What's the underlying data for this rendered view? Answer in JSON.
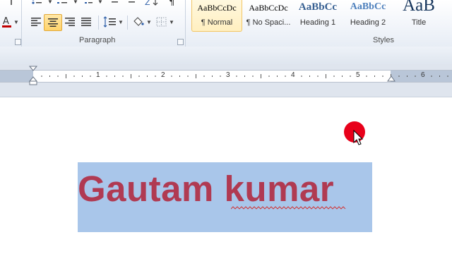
{
  "ribbon": {
    "groups": {
      "paragraph_label": "Paragraph",
      "styles_label": "Styles"
    },
    "styles": [
      {
        "sample": "AaBbCcDc",
        "name": "¶ Normal",
        "selected": true
      },
      {
        "sample": "AaBbCcDc",
        "name": "¶ No Spaci...",
        "selected": false
      },
      {
        "sample": "AaBbCc",
        "name": "Heading 1",
        "selected": false
      },
      {
        "sample": "AaBbCc",
        "name": "Heading 2",
        "selected": false
      },
      {
        "sample": "AaB",
        "name": "Title",
        "selected": false
      }
    ],
    "font_color_accent": "#c00000",
    "heading_color": "#365f91"
  },
  "ruler": {
    "numbers": [
      "1",
      "2",
      "3",
      "4",
      "5",
      "6"
    ]
  },
  "document": {
    "text": "Gautam kumar",
    "text_color": "#b03a52",
    "selection_color": "#a9c6ea"
  },
  "cursor_highlight_color": "#e8001a"
}
